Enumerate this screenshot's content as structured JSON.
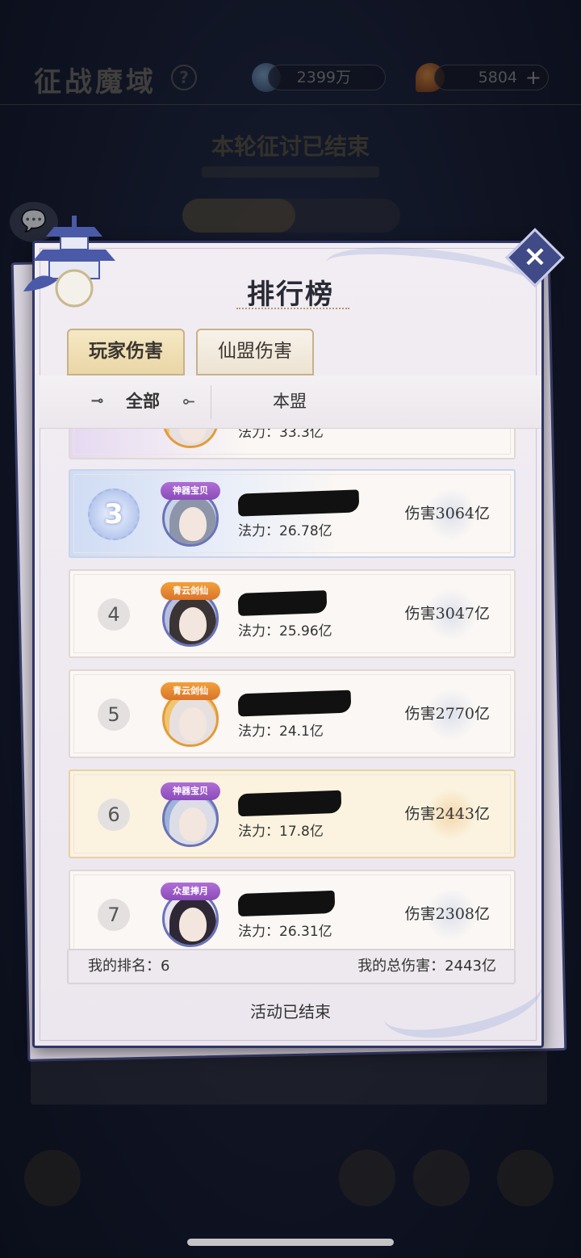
{
  "header": {
    "title": "征战魔域",
    "help_icon": "question-icon",
    "currency_1": {
      "icon": "jade-coin-icon",
      "value": "2399万"
    },
    "currency_2": {
      "icon": "fire-gem-icon",
      "value": "5804",
      "add": "+"
    }
  },
  "background": {
    "round_status": "本轮征讨已结束",
    "chat_icon": "chat-icon"
  },
  "modal": {
    "title": "排行榜",
    "close": "×",
    "tabs": [
      {
        "label": "玩家伤害",
        "active": true
      },
      {
        "label": "仙盟伤害",
        "active": false
      }
    ],
    "filters": [
      {
        "label": "全部",
        "active": true
      },
      {
        "label": "本盟",
        "active": false
      }
    ],
    "partial_row": {
      "power": "法力：33.3亿"
    },
    "rows": [
      {
        "rank": "3",
        "title_frame": "神器宝贝",
        "power": "法力：26.78亿",
        "damage": "伤害3064亿"
      },
      {
        "rank": "4",
        "title_frame": "青云剑仙",
        "power": "法力：25.96亿",
        "damage": "伤害3047亿"
      },
      {
        "rank": "5",
        "title_frame": "青云剑仙",
        "power": "法力：24.1亿",
        "damage": "伤害2770亿"
      },
      {
        "rank": "6",
        "title_frame": "神器宝贝",
        "power": "法力：17.8亿",
        "damage": "伤害2443亿",
        "is_self": true
      },
      {
        "rank": "7",
        "title_frame": "众星捧月",
        "power": "法力：26.31亿",
        "damage": "伤害2308亿"
      }
    ],
    "my_rank": "我的排名：6",
    "my_total_damage": "我的总伤害：2443亿",
    "footer_status": "活动已结束"
  }
}
